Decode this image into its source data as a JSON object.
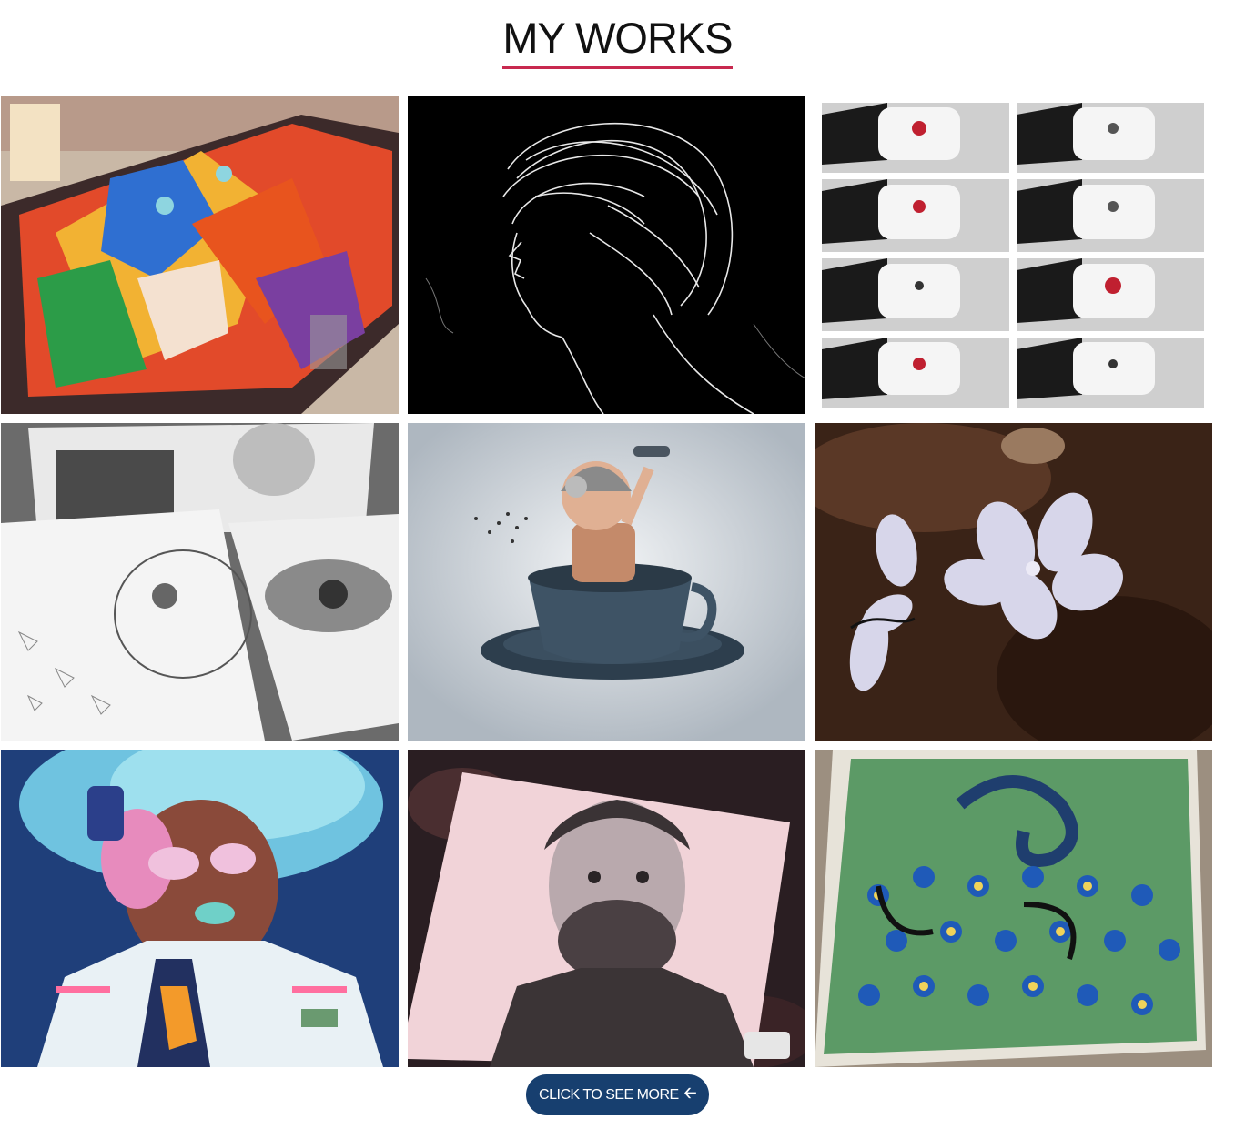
{
  "heading": {
    "title": "MY WORKS"
  },
  "gallery": {
    "items": [
      {
        "subject": "colorful lion painting"
      },
      {
        "subject": "white line drawing of woman"
      },
      {
        "subject": "logo mockups grid"
      },
      {
        "subject": "pencil sketches"
      },
      {
        "subject": "baby in coffee cup"
      },
      {
        "subject": "white flowers on soil"
      },
      {
        "subject": "girl with headphones illustration"
      },
      {
        "subject": "pencil portrait of man"
      },
      {
        "subject": "peacock mosaic"
      }
    ]
  },
  "cta": {
    "label": "CLICK TO SEE MORE",
    "icon": "arrow-left-icon"
  },
  "colors": {
    "accent": "#c8294f",
    "button": "#173f6f"
  }
}
